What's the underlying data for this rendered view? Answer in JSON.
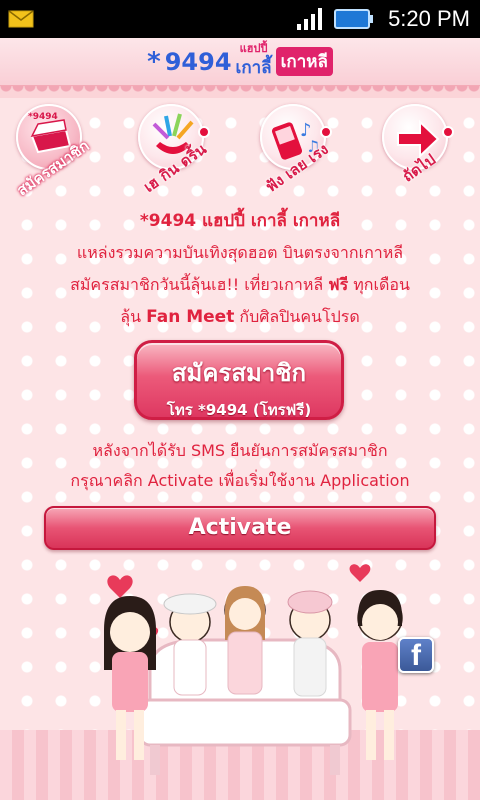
{
  "status_bar": {
    "time": "5:20 PM",
    "icons": [
      "mail-icon",
      "signal-icon",
      "battery-icon"
    ]
  },
  "header": {
    "logo_star": "*",
    "logo_code": "9494",
    "logo_small": "แฮปปี้",
    "logo_word1": "เกาลี้",
    "logo_word2": "เกาหลี"
  },
  "nav": {
    "items": [
      {
        "label": "สมัครสมาชิก",
        "icon": "register-icon",
        "badge": "*9494"
      },
      {
        "label": "เฮ กิน ดริ้น",
        "icon": "party-icon"
      },
      {
        "label": "ฟัง เลย เรง",
        "icon": "music-phone-icon"
      },
      {
        "label": "ถัดไป",
        "icon": "next-arrow-icon"
      }
    ]
  },
  "intro": {
    "line1": "*9494 แฮปปี้ เกาลี้ เกาหลี",
    "line2": "แหล่งรวมความบันเทิงสุดฮอต บินตรงจากเกาหลี",
    "line3_a": "สมัครสมาชิกวันนี้ลุ้นเฮ!! เที่ยวเกาหลี ",
    "line3_b": "ฟรี",
    "line3_c": " ทุกเดือน",
    "line4_a": "ลุ้น ",
    "line4_b": "Fan Meet",
    "line4_c": " กับศิลปินคนโปรด"
  },
  "subscribe_button": {
    "title": "สมัครสมาชิก",
    "subtitle": "โทร *9494 (โทรฟรี)"
  },
  "info": {
    "line1": "หลังจากได้รับ SMS ยืนยันการสมัครสมาชิก",
    "line2": "กรุณาคลิก Activate เพื่อเริ่มใช้งาน Application"
  },
  "activate_button": {
    "label": "Activate"
  },
  "facebook": {
    "label": "f"
  },
  "colors": {
    "accent": "#e0233f",
    "button": "#de3861",
    "background": "#fde4e6"
  }
}
